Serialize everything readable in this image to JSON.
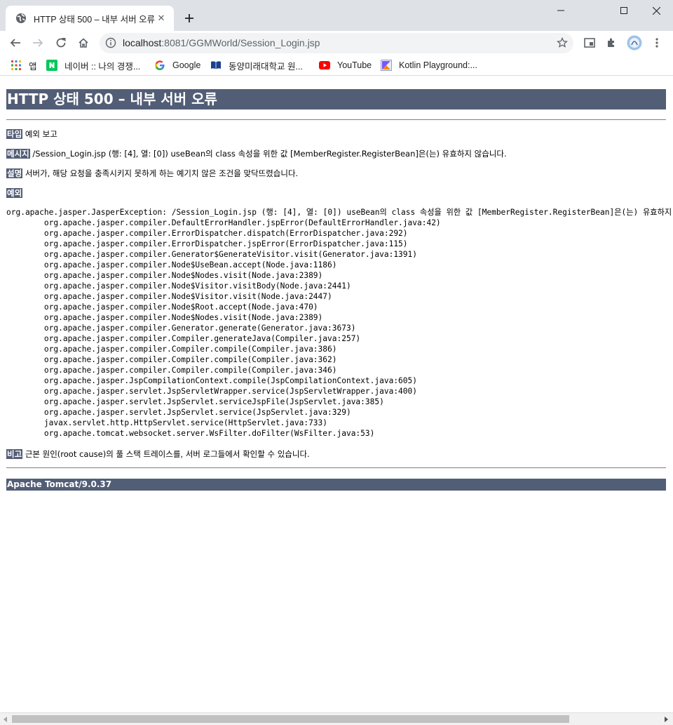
{
  "browser": {
    "tab_title": "HTTP 상태 500 – 내부 서버 오류",
    "url_host": "localhost",
    "url_path": ":8081/GGMWorld/Session_Login.jsp",
    "bookmarks": [
      {
        "label": "앱",
        "icon": "apps-grid-icon"
      },
      {
        "label": "네이버 :: 나의 경쟁...",
        "icon": "naver-icon"
      },
      {
        "label": "Google",
        "icon": "google-icon"
      },
      {
        "label": "동양미래대학교 원...",
        "icon": "book-icon"
      },
      {
        "label": "YouTube",
        "icon": "youtube-icon"
      },
      {
        "label": "Kotlin Playground:...",
        "icon": "kotlin-icon"
      }
    ]
  },
  "page": {
    "heading": "HTTP 상태 500 – 내부 서버 오류",
    "type_label": "타입",
    "type_value": "예외 보고",
    "message_label": "메시지",
    "message_value": "/Session_Login.jsp (행: [4], 열: [0]) useBean의 class 속성을 위한 값 [MemberRegister.RegisterBean]은(는) 유효하지 않습니다.",
    "description_label": "설명",
    "description_value": "서버가, 해당 요청을 충족시키지 못하게 하는 예기치 않은 조건을 맞닥뜨렸습니다.",
    "exception_label": "예외",
    "stack_trace": "org.apache.jasper.JasperException: /Session_Login.jsp (행: [4], 열: [0]) useBean의 class 속성을 위한 값 [MemberRegister.RegisterBean]은(는) 유효하지 않습니다.\n\torg.apache.jasper.compiler.DefaultErrorHandler.jspError(DefaultErrorHandler.java:42)\n\torg.apache.jasper.compiler.ErrorDispatcher.dispatch(ErrorDispatcher.java:292)\n\torg.apache.jasper.compiler.ErrorDispatcher.jspError(ErrorDispatcher.java:115)\n\torg.apache.jasper.compiler.Generator$GenerateVisitor.visit(Generator.java:1391)\n\torg.apache.jasper.compiler.Node$UseBean.accept(Node.java:1186)\n\torg.apache.jasper.compiler.Node$Nodes.visit(Node.java:2389)\n\torg.apache.jasper.compiler.Node$Visitor.visitBody(Node.java:2441)\n\torg.apache.jasper.compiler.Node$Visitor.visit(Node.java:2447)\n\torg.apache.jasper.compiler.Node$Root.accept(Node.java:470)\n\torg.apache.jasper.compiler.Node$Nodes.visit(Node.java:2389)\n\torg.apache.jasper.compiler.Generator.generate(Generator.java:3673)\n\torg.apache.jasper.compiler.Compiler.generateJava(Compiler.java:257)\n\torg.apache.jasper.compiler.Compiler.compile(Compiler.java:386)\n\torg.apache.jasper.compiler.Compiler.compile(Compiler.java:362)\n\torg.apache.jasper.compiler.Compiler.compile(Compiler.java:346)\n\torg.apache.jasper.JspCompilationContext.compile(JspCompilationContext.java:605)\n\torg.apache.jasper.servlet.JspServletWrapper.service(JspServletWrapper.java:400)\n\torg.apache.jasper.servlet.JspServlet.serviceJspFile(JspServlet.java:385)\n\torg.apache.jasper.servlet.JspServlet.service(JspServlet.java:329)\n\tjavax.servlet.http.HttpServlet.service(HttpServlet.java:733)\n\torg.apache.tomcat.websocket.server.WsFilter.doFilter(WsFilter.java:53)",
    "note_label": "비고",
    "note_value": "근본 원인(root cause)의 풀 스택 트레이스를, 서버 로그들에서 확인할 수 있습니다.",
    "footer": "Apache Tomcat/9.0.37"
  },
  "colors": {
    "tomcat_header": "#525d76",
    "chrome_frame": "#dee1e6",
    "omnibox": "#f1f3f4"
  }
}
